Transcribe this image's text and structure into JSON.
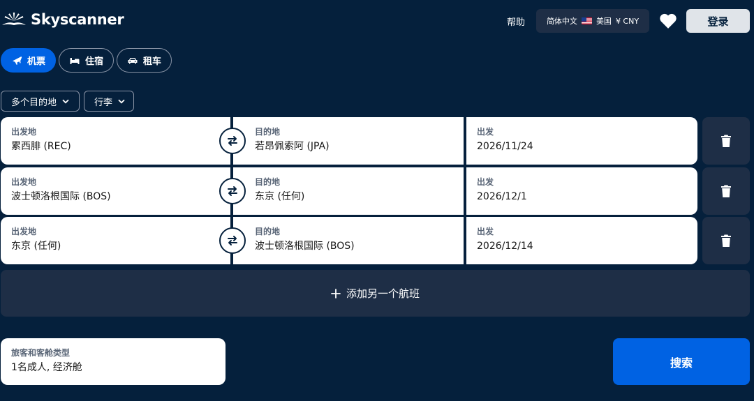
{
  "header": {
    "brand": "Skyscanner",
    "help": "帮助",
    "locale": {
      "language": "简体中文",
      "region": "美国",
      "currency": "¥ CNY"
    },
    "login": "登录"
  },
  "tabs": [
    {
      "label": "机票",
      "icon": "airplane-icon",
      "active": true
    },
    {
      "label": "住宿",
      "icon": "bed-icon",
      "active": false
    },
    {
      "label": "租车",
      "icon": "car-icon",
      "active": false
    }
  ],
  "options": {
    "trip_type": "多个目的地",
    "baggage": "行李"
  },
  "legs": [
    {
      "from_label": "出发地",
      "from": "累西腓 (REC)",
      "to_label": "目的地",
      "to": "若昂佩索阿 (JPA)",
      "date_label": "出发",
      "date": "2026/11/24"
    },
    {
      "from_label": "出发地",
      "from": "波士顿洛根国际 (BOS)",
      "to_label": "目的地",
      "to": "东京 (任何)",
      "date_label": "出发",
      "date": "2026/12/1"
    },
    {
      "from_label": "出发地",
      "from": "东京 (任何)",
      "to_label": "目的地",
      "to": "波士顿洛根国际 (BOS)",
      "date_label": "出发",
      "date": "2026/12/14"
    }
  ],
  "add_flight": "添加另一个航班",
  "travellers": {
    "label": "旅客和客舱类型",
    "value": "1名成人, 经济舱"
  },
  "search": "搜索",
  "colors": {
    "background": "#05203c",
    "accent": "#0062e3",
    "panel": "#1e2e46"
  }
}
